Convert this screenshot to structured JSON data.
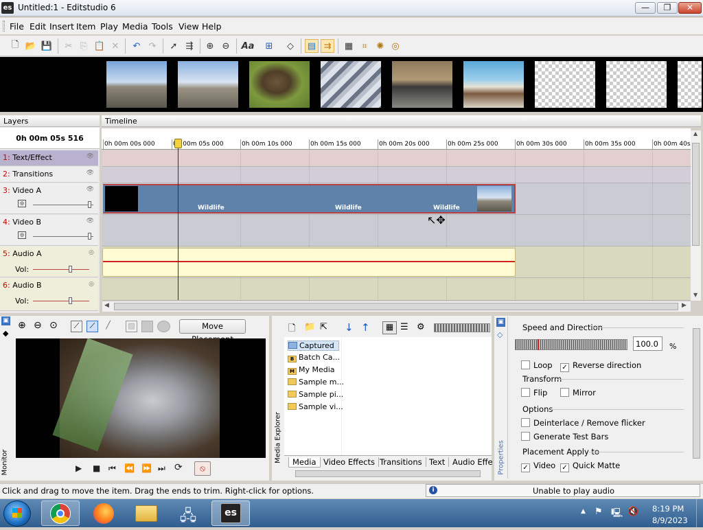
{
  "window": {
    "app_icon_text": "es",
    "title": "Untitled:1 - Editstudio 6",
    "controls": {
      "minimize": "—",
      "maximize": "❐",
      "close": "✕"
    }
  },
  "menu": [
    "File",
    "Edit",
    "Insert",
    "Item",
    "Play",
    "Media",
    "Tools",
    "View",
    "Help"
  ],
  "toolbar_icons": [
    "new-file-icon",
    "open-folder-icon",
    "save-icon",
    "cut-icon",
    "copy-icon",
    "paste-icon",
    "delete-icon",
    "undo-icon",
    "redo-icon",
    "pointer-icon",
    "multi-select-icon",
    "zoom-in-icon",
    "zoom-out-icon",
    "text-icon",
    "align-icon",
    "keyframe-icon",
    "layers-icon",
    "snap-icon",
    "film-icon",
    "crop-icon",
    "sparkle-icon",
    "target-icon"
  ],
  "filmstrip": {
    "thumbnails": [
      "penguins",
      "penguins-wide",
      "marmot",
      "pigeons",
      "seals",
      "horses-beach",
      "empty",
      "empty",
      "empty"
    ]
  },
  "layers": {
    "header": "Layers",
    "time": "0h 00m 05s 516",
    "items": [
      {
        "num": "1:",
        "name": "Text/Effect"
      },
      {
        "num": "2:",
        "name": "Transitions"
      },
      {
        "num": "3:",
        "name": "Video A"
      },
      {
        "num": "4:",
        "name": "Video B"
      },
      {
        "num": "5:",
        "name": "Audio A",
        "vol_label": "Vol:"
      },
      {
        "num": "6:",
        "name": "Audio B",
        "vol_label": "Vol:"
      }
    ]
  },
  "timeline": {
    "header": "Timeline",
    "ticks": [
      "0h 00m 00s 000",
      "0h 00m 05s 000",
      "0h 00m 10s 000",
      "0h 00m 15s 000",
      "0h 00m 20s 000",
      "0h 00m 25s 000",
      "0h 00m 30s 000",
      "0h 00m 35s 000",
      "0h 00m 40s"
    ],
    "clip_labels": [
      "Wildlife",
      "Wildlife",
      "Wildlife"
    ]
  },
  "monitor": {
    "label": "Monitor",
    "move_placement": "Move Placement",
    "controls": [
      "▶",
      "■",
      "⏮",
      "⏪",
      "⏩",
      "⏭",
      "⟳"
    ]
  },
  "media_explorer": {
    "label": "Media Explorer",
    "folders": [
      "Captured",
      "Batch Ca...",
      "My Media",
      "Sample m...",
      "Sample pi...",
      "Sample vi..."
    ],
    "folder_badges": [
      "",
      "B",
      "M",
      "",
      "",
      ""
    ],
    "tabs": [
      "Media",
      "Video Effects",
      "Transitions",
      "Text",
      "Audio Effe"
    ]
  },
  "properties": {
    "label": "Properties",
    "speed_title": "Speed and Direction",
    "speed_value": "100.0",
    "speed_unit": "%",
    "loop": {
      "label": "Loop",
      "checked": false
    },
    "reverse": {
      "label": "Reverse direction",
      "checked": true
    },
    "transform_title": "Transform",
    "flip": {
      "label": "Flip",
      "checked": false
    },
    "mirror": {
      "label": "Mirror",
      "checked": false
    },
    "options_title": "Options",
    "deinterlace": {
      "label": "Deinterlace / Remove flicker",
      "checked": false
    },
    "testbars": {
      "label": "Generate Test Bars",
      "checked": false
    },
    "placement_title": "Placement Apply to",
    "video": {
      "label": "Video",
      "checked": true
    },
    "quickmatte": {
      "label": "Quick Matte",
      "checked": true
    }
  },
  "status": {
    "message": "Click and drag to move the item. Drag the ends to trim. Right-click for options.",
    "audio_info_icon": "i",
    "audio": "Unable to play audio"
  },
  "taskbar": {
    "apps": [
      "chrome",
      "firefox",
      "file-explorer",
      "network-tool",
      "editstudio"
    ],
    "editstudio_label": "es",
    "time": "8:19 PM",
    "date": "8/9/2023"
  }
}
